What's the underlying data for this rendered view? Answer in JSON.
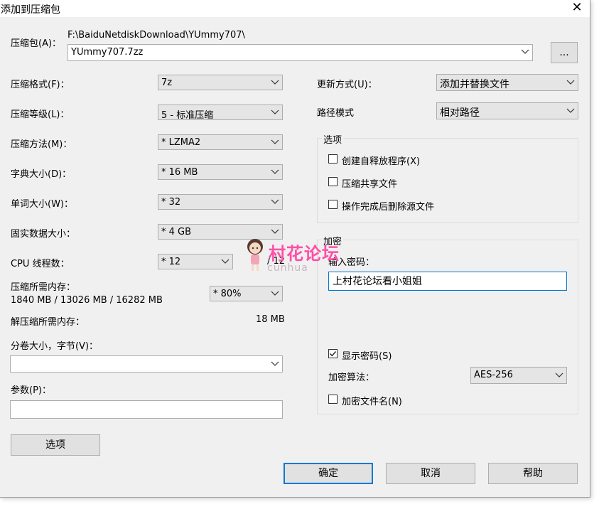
{
  "window": {
    "title": "添加到压缩包",
    "close_glyph": "✕"
  },
  "archive": {
    "label": "压缩包(A)：",
    "path": "F:\\BaiduNetdiskDownload\\YUmmy707\\",
    "name": "YUmmy707.7zz",
    "browse_label": "..."
  },
  "left": {
    "format": {
      "label": "压缩格式(F)：",
      "value": "7z"
    },
    "level": {
      "label": "压缩等级(L)：",
      "value": "5 - 标准压缩"
    },
    "method": {
      "label": "压缩方法(M)：",
      "value": "* LZMA2"
    },
    "dict": {
      "label": "字典大小(D)：",
      "value": "* 16 MB"
    },
    "word": {
      "label": "单词大小(W)：",
      "value": "* 32"
    },
    "solid": {
      "label": "固实数据大小：",
      "value": "* 4 GB"
    },
    "cpu": {
      "label": "CPU 线程数：",
      "value": "* 12",
      "max": "/ 12"
    },
    "mem_compress": {
      "label": "压缩所需内存：",
      "detail": "1840 MB / 13026 MB / 16282 MB",
      "percent": "* 80%"
    },
    "mem_decompress": {
      "label": "解压缩所需内存：",
      "value": "18 MB"
    },
    "volume": {
      "label": "分卷大小，字节(V)：",
      "value": ""
    },
    "params": {
      "label": "参数(P)：",
      "value": ""
    },
    "options_button": "选项"
  },
  "right": {
    "update": {
      "label": "更新方式(U)：",
      "value": "添加并替换文件"
    },
    "pathmode": {
      "label": "路径模式",
      "value": "相对路径"
    },
    "options_group": {
      "title": "选项",
      "sfx": {
        "label": "创建自释放程序(X)",
        "checked": false
      },
      "shared": {
        "label": "压缩共享文件",
        "checked": false
      },
      "delete": {
        "label": "操作完成后删除源文件",
        "checked": false
      }
    },
    "encryption": {
      "title": "加密",
      "password_label": "输入密码：",
      "password": "上村花论坛看小姐姐",
      "show_password": {
        "label": "显示密码(S)",
        "checked": true
      },
      "method_label": "加密算法：",
      "method_value": "AES-256",
      "encrypt_names": {
        "label": "加密文件名(N)",
        "checked": false
      }
    }
  },
  "footer": {
    "ok": "确定",
    "cancel": "取消",
    "help": "帮助"
  },
  "watermark": {
    "title": "村花论坛",
    "sub": "cunhua"
  },
  "colors": {
    "window_bg": "#f0f0f0",
    "accent": "#0078d7",
    "watermark": "#ff4fa6"
  }
}
